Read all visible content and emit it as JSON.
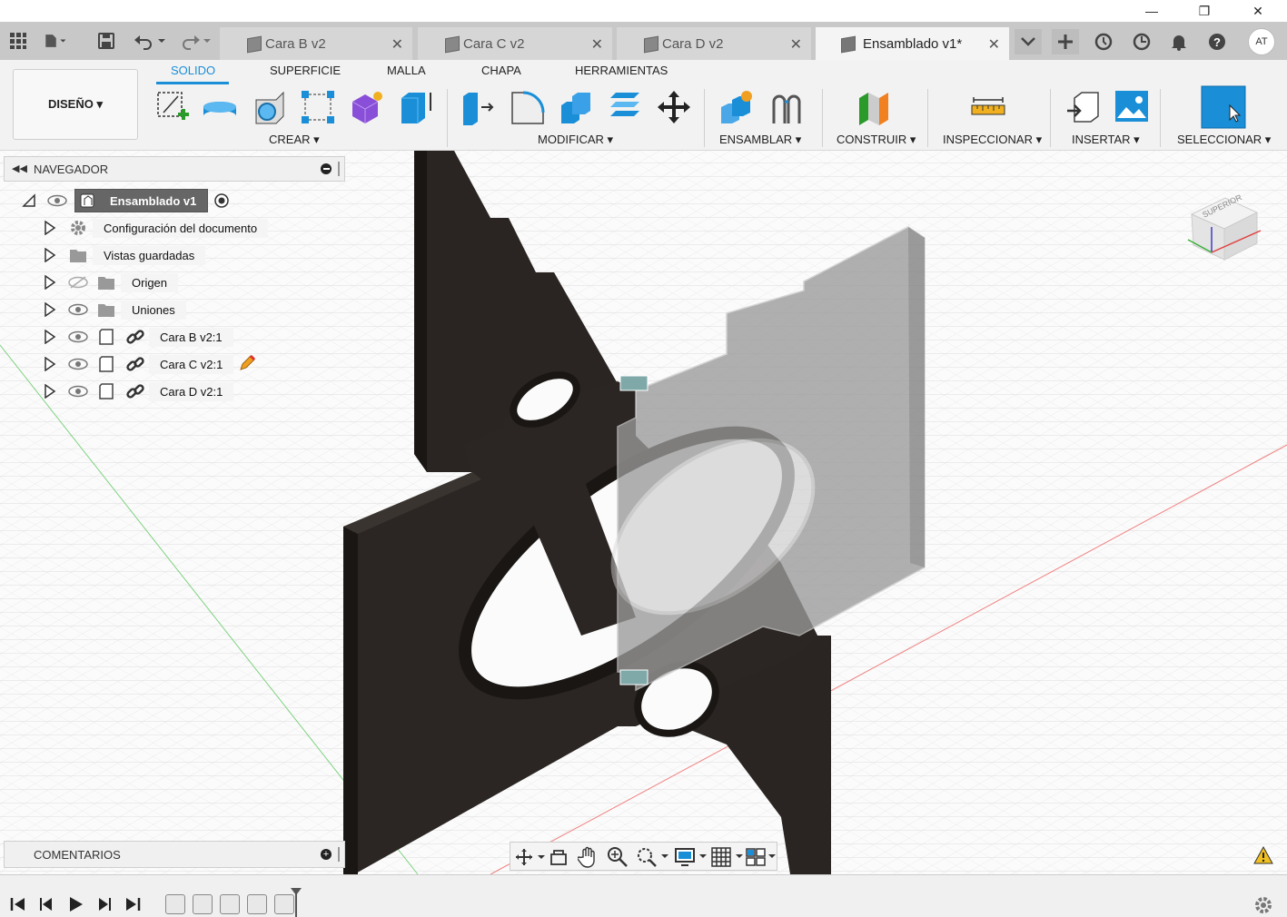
{
  "window": {
    "minimize": "—",
    "restore": "❐",
    "close": "✕"
  },
  "tabs": [
    {
      "label": "Cara B v2"
    },
    {
      "label": "Cara C v2"
    },
    {
      "label": "Cara D v2"
    },
    {
      "label": "Ensamblado v1*"
    }
  ],
  "tab_close": "✕",
  "user_initials": "AT",
  "workspace": {
    "label": "DISEÑO ▾"
  },
  "toolbar_tabs": [
    "SOLIDO",
    "SUPERFICIE",
    "MALLA",
    "CHAPA",
    "HERRAMIENTAS"
  ],
  "groups": {
    "crear": "CREAR ▾",
    "modificar": "MODIFICAR ▾",
    "ensamblar": "ENSAMBLAR ▾",
    "construir": "CONSTRUIR ▾",
    "inspeccionar": "INSPECCIONAR ▾",
    "insertar": "INSERTAR ▾",
    "seleccionar": "SELECCIONAR ▾"
  },
  "navigator": {
    "title": "NAVEGADOR",
    "root": "Ensamblado v1",
    "items": [
      {
        "label": "Configuración del documento"
      },
      {
        "label": "Vistas guardadas"
      },
      {
        "label": "Origen"
      },
      {
        "label": "Uniones"
      },
      {
        "label": "Cara B v2:1"
      },
      {
        "label": "Cara C v2:1"
      },
      {
        "label": "Cara D v2:1"
      }
    ]
  },
  "comments": {
    "title": "COMENTARIOS"
  },
  "viewcube": {
    "label": "SUPERIOR"
  },
  "colors": {
    "accent": "#1a8fd8",
    "wood": "#2a2522",
    "ghost": "#9a9a9a"
  }
}
